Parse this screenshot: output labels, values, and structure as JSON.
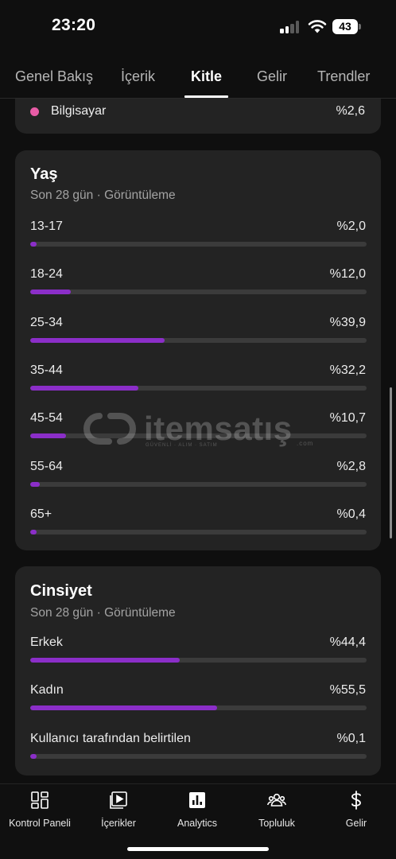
{
  "status_bar": {
    "time": "23:20",
    "battery": "43"
  },
  "tabs": [
    {
      "label": "Genel Bakış"
    },
    {
      "label": "İçerik"
    },
    {
      "label": "Kitle"
    },
    {
      "label": "Gelir"
    },
    {
      "label": "Trendler"
    }
  ],
  "active_tab": "Kitle",
  "device_partial": {
    "label": "Bilgisayar",
    "value": "%2,6",
    "dot_color": "#e85ca6"
  },
  "age_card": {
    "title": "Yaş",
    "subtitle": "Son 28 gün · Görüntüleme",
    "rows": [
      {
        "label": "13-17",
        "value": "%2,0",
        "percent": 2.0
      },
      {
        "label": "18-24",
        "value": "%12,0",
        "percent": 12.0
      },
      {
        "label": "25-34",
        "value": "%39,9",
        "percent": 39.9
      },
      {
        "label": "35-44",
        "value": "%32,2",
        "percent": 32.2
      },
      {
        "label": "45-54",
        "value": "%10,7",
        "percent": 10.7
      },
      {
        "label": "55-64",
        "value": "%2,8",
        "percent": 2.8
      },
      {
        "label": "65+",
        "value": "%0,4",
        "percent": 0.4
      }
    ]
  },
  "gender_card": {
    "title": "Cinsiyet",
    "subtitle": "Son 28 gün · Görüntüleme",
    "rows": [
      {
        "label": "Erkek",
        "value": "%44,4",
        "percent": 44.4
      },
      {
        "label": "Kadın",
        "value": "%55,5",
        "percent": 55.5
      },
      {
        "label": "Kullanıcı tarafından belirtilen",
        "value": "%0,1",
        "percent": 0.1
      }
    ]
  },
  "bar_color": "#8b2ec8",
  "watermark": {
    "text": "itemsatış",
    "subtext": "GÜVENLİ · ALIM · SATIM",
    "domain": ".com"
  },
  "bottom_nav": [
    {
      "label": "Kontrol Paneli",
      "icon": "dashboard-icon"
    },
    {
      "label": "İçerikler",
      "icon": "content-icon"
    },
    {
      "label": "Analytics",
      "icon": "analytics-icon"
    },
    {
      "label": "Topluluk",
      "icon": "community-icon"
    },
    {
      "label": "Gelir",
      "icon": "dollar-icon"
    }
  ]
}
